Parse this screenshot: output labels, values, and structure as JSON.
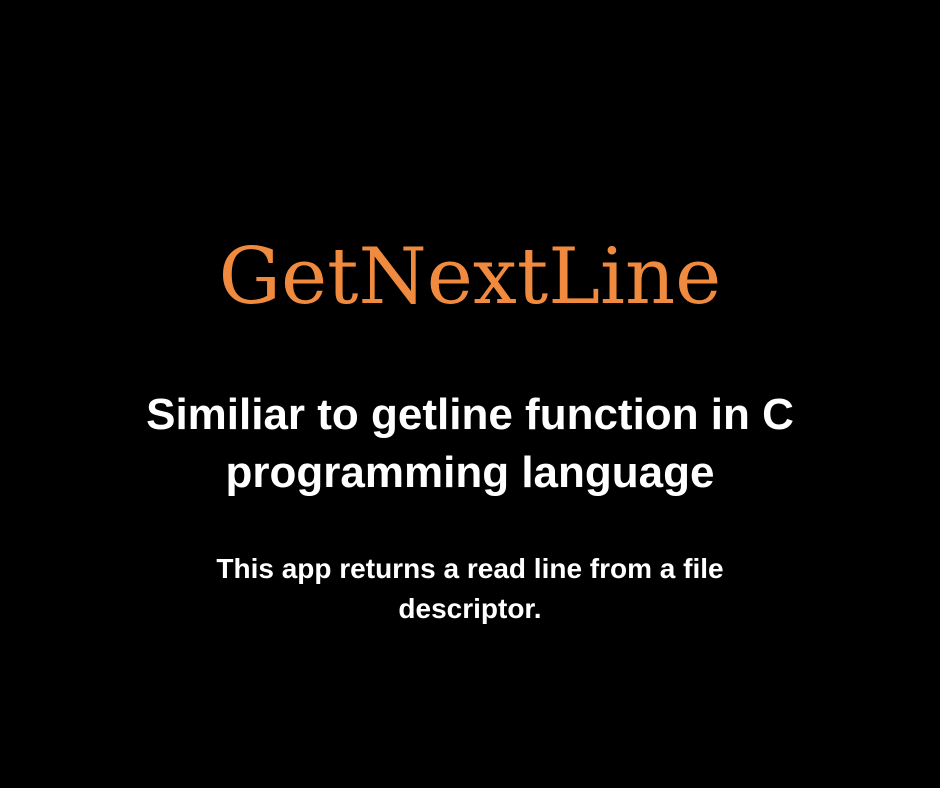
{
  "title": "GetNextLine",
  "subtitle": {
    "line1": "Similiar to getline function in C",
    "line2": "programming language"
  },
  "description": {
    "line1": "This app returns a read line from a file",
    "line2": "descriptor."
  },
  "colors": {
    "background": "#000000",
    "title": "#f08a3e",
    "text": "#ffffff"
  }
}
